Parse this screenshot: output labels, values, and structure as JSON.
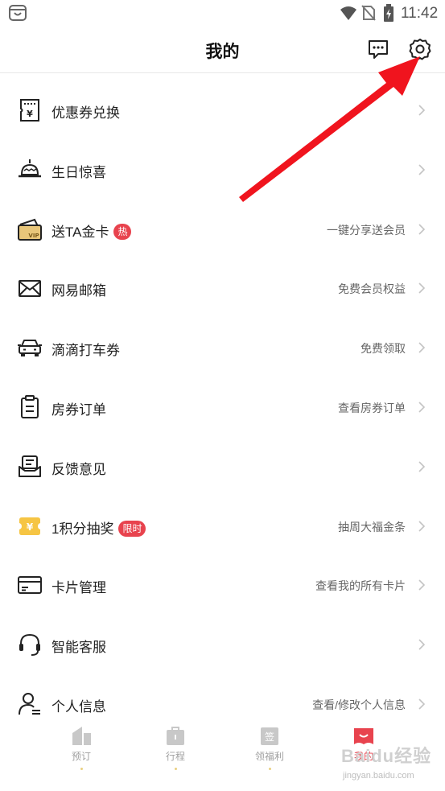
{
  "status_bar": {
    "time": "11:42"
  },
  "header": {
    "title": "我的"
  },
  "menu": [
    {
      "icon": "coupon-ticket-icon",
      "label": "优惠券兑换",
      "badge": "",
      "hint": ""
    },
    {
      "icon": "birthday-cake-icon",
      "label": "生日惊喜",
      "badge": "",
      "hint": ""
    },
    {
      "icon": "vip-card-icon",
      "label": "送TA金卡",
      "badge": "热",
      "hint": "一键分享送会员"
    },
    {
      "icon": "mail-envelope-icon",
      "label": "网易邮箱",
      "badge": "",
      "hint": "免费会员权益"
    },
    {
      "icon": "car-icon",
      "label": "滴滴打车券",
      "badge": "",
      "hint": "免费领取"
    },
    {
      "icon": "clipboard-icon",
      "label": "房券订单",
      "badge": "",
      "hint": "查看房券订单"
    },
    {
      "icon": "feedback-icon",
      "label": "反馈意见",
      "badge": "",
      "hint": ""
    },
    {
      "icon": "points-lottery-icon",
      "label": "1积分抽奖",
      "badge": "限时",
      "hint": "抽周大福金条"
    },
    {
      "icon": "card-icon",
      "label": "卡片管理",
      "badge": "",
      "hint": "查看我的所有卡片"
    },
    {
      "icon": "headset-icon",
      "label": "智能客服",
      "badge": "",
      "hint": ""
    },
    {
      "icon": "user-profile-icon",
      "label": "个人信息",
      "badge": "",
      "hint": "查看/修改个人信息"
    }
  ],
  "tabs": [
    {
      "icon": "hotel-building-icon",
      "label": "预订",
      "active": false
    },
    {
      "icon": "suitcase-icon",
      "label": "行程",
      "active": false
    },
    {
      "icon": "sign-in-calendar-icon",
      "label": "领福利",
      "active": false
    },
    {
      "icon": "my-profile-icon",
      "label": "我的",
      "active": true
    }
  ],
  "watermark": {
    "text": "Baidu经验",
    "sub": "jingyan.baidu.com"
  },
  "colors": {
    "accent": "#e8434e",
    "arrow": "#f0141e",
    "icon": "#222222",
    "hint": "#666666"
  }
}
